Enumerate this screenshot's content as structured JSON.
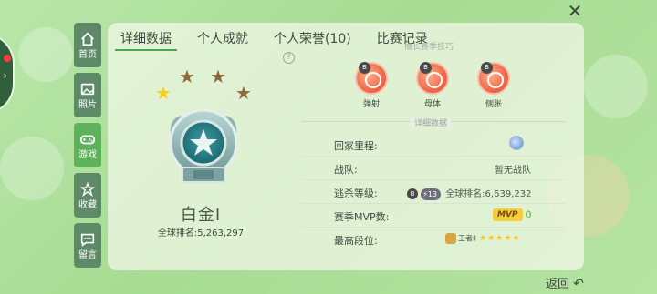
{
  "window": {
    "close_symbol": "✕"
  },
  "sidebar": {
    "items": [
      {
        "label": "首页",
        "icon": "home-icon"
      },
      {
        "label": "照片",
        "icon": "photo-icon"
      },
      {
        "label": "游戏",
        "icon": "gamepad-icon"
      },
      {
        "label": "收藏",
        "icon": "collection-icon"
      },
      {
        "label": "留言",
        "icon": "message-icon"
      }
    ],
    "active_index": 2
  },
  "tabs": [
    {
      "label": "详细数据",
      "active": true
    },
    {
      "label": "个人成就",
      "active": false
    },
    {
      "label": "个人荣誉(10)",
      "active": false
    },
    {
      "label": "比赛记录",
      "active": false
    }
  ],
  "rank": {
    "stars_lit": 1,
    "stars_total": 4,
    "name": "白金Ⅰ",
    "global_rank": "全球排名:5,263,297"
  },
  "skills": {
    "header_cut": "擅长赛季技巧",
    "items": [
      {
        "tag": "B",
        "name": "弹射"
      },
      {
        "tag": "B",
        "name": "母体"
      },
      {
        "tag": "B",
        "name": "侧胀"
      }
    ]
  },
  "stats": {
    "section_title": "详细数据",
    "rows": [
      {
        "label": "回家里程:",
        "value": ""
      },
      {
        "label": "战队:",
        "value": "暂无战队"
      },
      {
        "label": "逃杀等级:",
        "level_badge": "B",
        "level": "13",
        "global_rank": "全球排名:6,639,232"
      },
      {
        "label": "赛季MVP数:",
        "mvp_text": "MVP",
        "mvp_count": "0"
      },
      {
        "label": "最高段位:",
        "tier_name": "王者Ⅱ",
        "tier_stars": "★★★★★"
      }
    ]
  },
  "footer": {
    "back_label": "返回",
    "back_symbol": "↶"
  },
  "colors": {
    "accent_green": "#4aa656",
    "panel": "#ebf5e0",
    "nav_bg": "#5e8a67",
    "skill_orange": "#f06a4a"
  }
}
